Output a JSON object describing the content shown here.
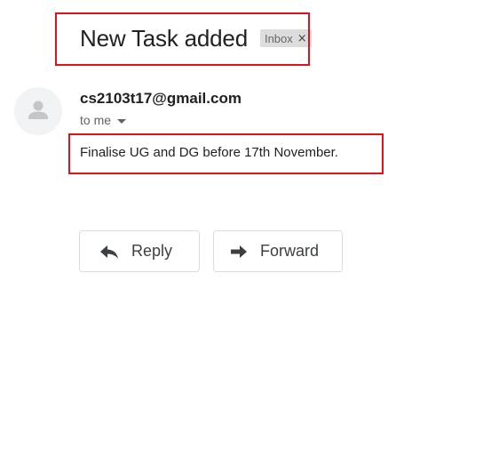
{
  "email": {
    "subject": "New Task added",
    "label": "Inbox",
    "label_remove": "×",
    "sender": "cs2103t17@gmail.com",
    "recipient": "to me",
    "body": "Finalise UG and DG before 17th November."
  },
  "actions": {
    "reply_label": "Reply",
    "forward_label": "Forward"
  },
  "colors": {
    "highlight": "#e0121b",
    "label_chip": "#dddddd",
    "button_border": "#dadce0"
  },
  "icons": {
    "avatar": "person-icon",
    "reply": "reply-icon",
    "forward": "forward-icon",
    "recipient_toggle": "chevron-down-icon"
  }
}
